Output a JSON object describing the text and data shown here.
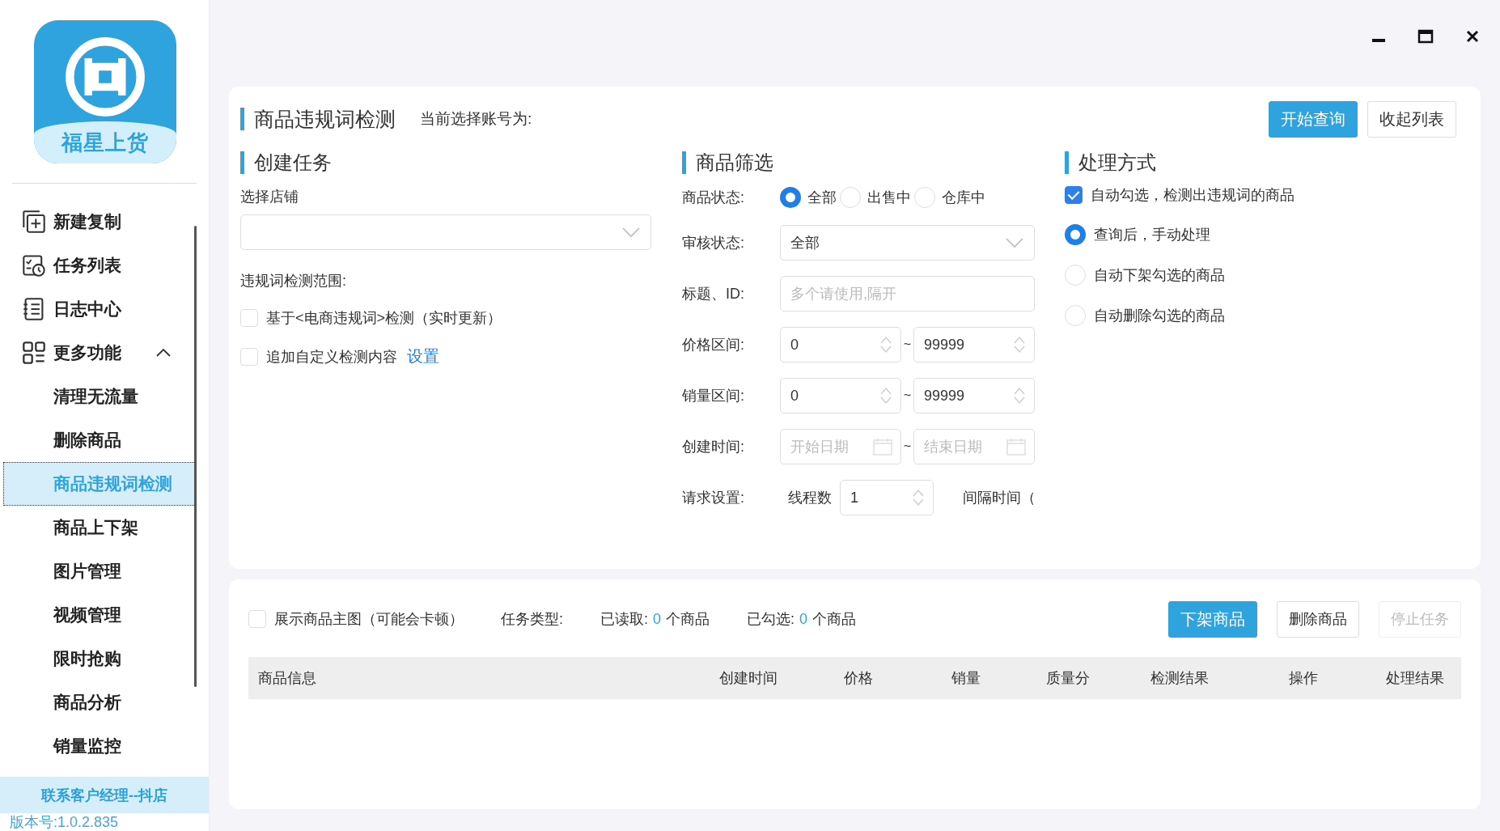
{
  "sidebar": {
    "logo_text": "福星上货",
    "items": [
      {
        "label": "新建复制",
        "kind": "main",
        "selected": false
      },
      {
        "label": "任务列表",
        "kind": "main",
        "selected": false
      },
      {
        "label": "日志中心",
        "kind": "main",
        "selected": false
      },
      {
        "label": "更多功能",
        "kind": "group",
        "expanded": true,
        "selected": false,
        "children": [
          {
            "label": "清理无流量",
            "selected": false
          },
          {
            "label": "删除商品",
            "selected": false
          },
          {
            "label": "商品违规词检测",
            "selected": true
          },
          {
            "label": "商品上下架",
            "selected": false
          },
          {
            "label": "图片管理",
            "selected": false
          },
          {
            "label": "视频管理",
            "selected": false
          },
          {
            "label": "限时抢购",
            "selected": false
          },
          {
            "label": "商品分析",
            "selected": false
          },
          {
            "label": "销量监控",
            "selected": false
          }
        ]
      }
    ],
    "contact": "联系客户经理--抖店",
    "version": "版本号:1.0.2.835"
  },
  "header": {
    "title": "商品违规词检测",
    "account_label": "当前选择账号为:",
    "buttons": [
      {
        "label": "开始查询",
        "kind": "primary"
      },
      {
        "label": "收起列表",
        "kind": "default"
      }
    ]
  },
  "create_task": {
    "heading": "创建任务",
    "store_label": "选择店铺",
    "scope_label": "违规词检测范围:",
    "options": [
      {
        "label": "基于<电商违规词>检测（实时更新）",
        "checked": false
      },
      {
        "label": "追加自定义检测内容",
        "checked": false,
        "link": "设置"
      }
    ]
  },
  "filter": {
    "heading": "商品筛选",
    "status_label": "商品状态:",
    "status_options": [
      {
        "label": "全部",
        "selected": true
      },
      {
        "label": "出售中",
        "selected": false
      },
      {
        "label": "仓库中",
        "selected": false
      }
    ],
    "review_label": "审核状态:",
    "review_value": "全部",
    "title_label": "标题、ID:",
    "title_placeholder": "多个请使用,隔开",
    "price_label": "价格区间:",
    "price_min": "0",
    "price_max": "99999",
    "range_sep": "~",
    "sales_label": "销量区间:",
    "sales_min": "0",
    "sales_max": "99999",
    "sales_sep": "~",
    "date_label": "创建时间:",
    "date_start_placeholder": "开始日期",
    "date_end_placeholder": "结束日期",
    "date_sep": "~",
    "request_label": "请求设置:",
    "threads_label": "线程数",
    "threads_value": "1",
    "interval_label": "间隔时间（"
  },
  "handling": {
    "heading": "处理方式",
    "auto_check": {
      "label": "自动勾选，检测出违规词的商品",
      "checked": true
    },
    "options": [
      {
        "label": "查询后，手动处理",
        "selected": true
      },
      {
        "label": "自动下架勾选的商品",
        "selected": false
      },
      {
        "label": "自动删除勾选的商品",
        "selected": false
      }
    ]
  },
  "results": {
    "show_image": {
      "label": "展示商品主图（可能会卡顿）",
      "checked": false
    },
    "task_type_label": "任务类型:",
    "read_label": "已读取:",
    "read_count": "0",
    "read_unit": "个商品",
    "checked_label": "已勾选:",
    "checked_count": "0",
    "checked_unit": "个商品",
    "buttons": [
      {
        "label": "下架商品",
        "kind": "primary",
        "disabled": false
      },
      {
        "label": "删除商品",
        "kind": "default",
        "disabled": false
      },
      {
        "label": "停止任务",
        "kind": "default",
        "disabled": true
      }
    ],
    "columns": [
      "商品信息",
      "创建时间",
      "价格",
      "销量",
      "质量分",
      "检测结果",
      "操作",
      "处理结果"
    ]
  }
}
